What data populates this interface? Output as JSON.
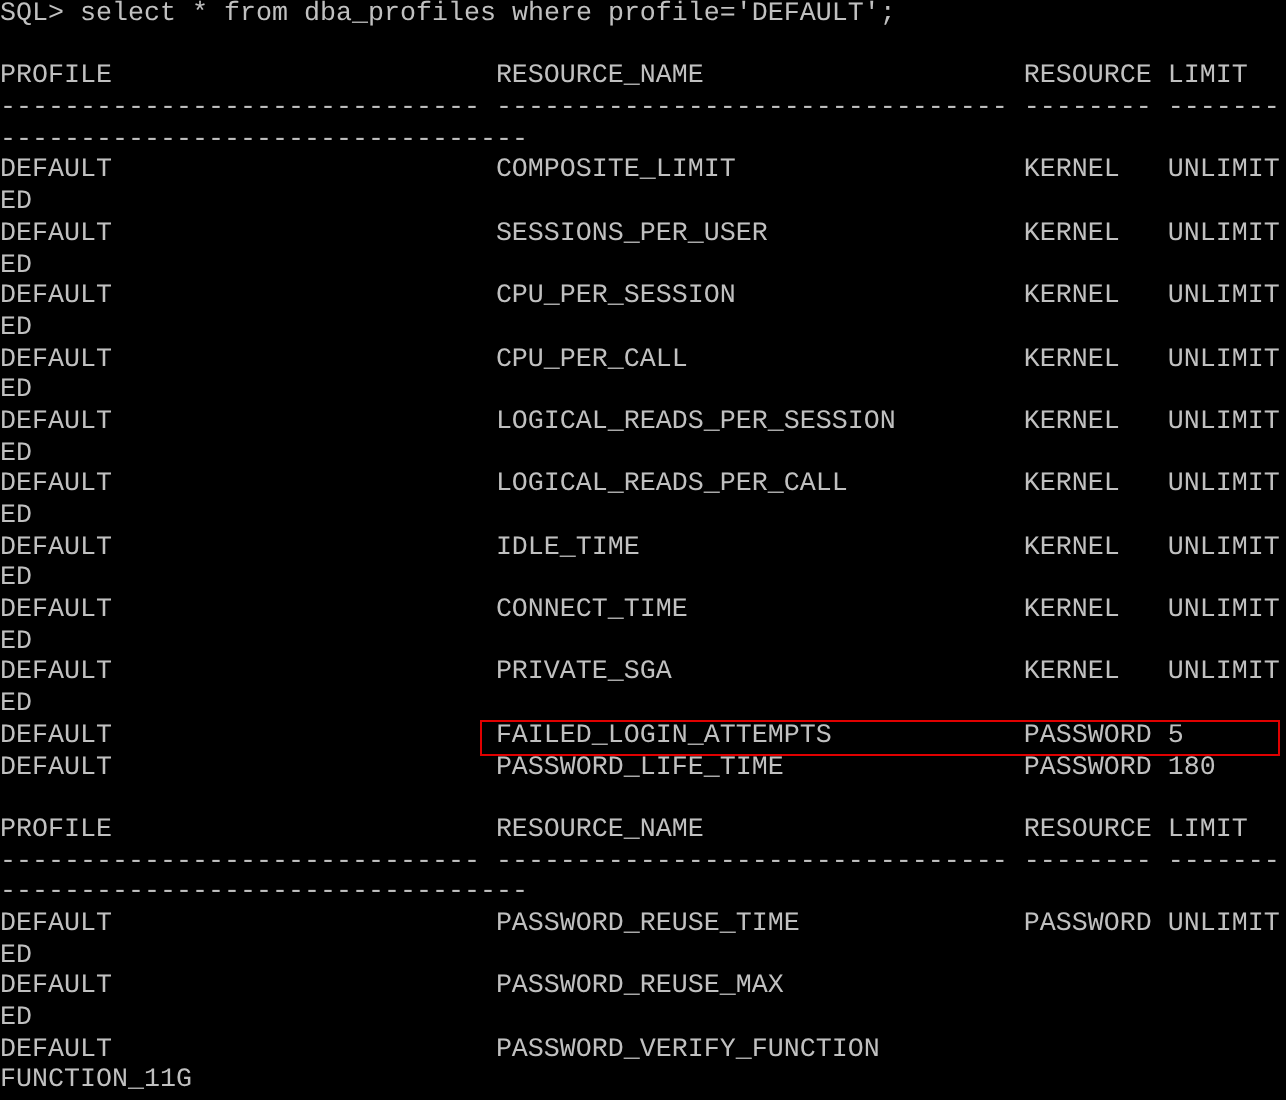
{
  "command": {
    "prompt": "SQL>",
    "text": "select * from dba_profiles where profile='DEFAULT';"
  },
  "result_blocks": [
    {
      "headers": {
        "profile": "PROFILE",
        "resource_name": "RESOURCE_NAME",
        "resource": "RESOURCE",
        "limit": "LIMIT"
      },
      "separator_1": "------------------------------ -------------------------------- -------- -------",
      "separator_2": "---------------------------------",
      "rows": [
        {
          "profile": "DEFAULT",
          "resource_name": "COMPOSITE_LIMIT",
          "resource": "KERNEL",
          "limit": "UNLIMIT",
          "limit_wrap": "ED",
          "highlighted": false
        },
        {
          "profile": "DEFAULT",
          "resource_name": "SESSIONS_PER_USER",
          "resource": "KERNEL",
          "limit": "UNLIMIT",
          "limit_wrap": "ED",
          "highlighted": false
        },
        {
          "profile": "DEFAULT",
          "resource_name": "CPU_PER_SESSION",
          "resource": "KERNEL",
          "limit": "UNLIMIT",
          "limit_wrap": "ED",
          "highlighted": false
        },
        {
          "profile": "DEFAULT",
          "resource_name": "CPU_PER_CALL",
          "resource": "KERNEL",
          "limit": "UNLIMIT",
          "limit_wrap": "ED",
          "highlighted": false
        },
        {
          "profile": "DEFAULT",
          "resource_name": "LOGICAL_READS_PER_SESSION",
          "resource": "KERNEL",
          "limit": "UNLIMIT",
          "limit_wrap": "ED",
          "highlighted": false
        },
        {
          "profile": "DEFAULT",
          "resource_name": "LOGICAL_READS_PER_CALL",
          "resource": "KERNEL",
          "limit": "UNLIMIT",
          "limit_wrap": "ED",
          "highlighted": false
        },
        {
          "profile": "DEFAULT",
          "resource_name": "IDLE_TIME",
          "resource": "KERNEL",
          "limit": "UNLIMIT",
          "limit_wrap": "ED",
          "highlighted": false
        },
        {
          "profile": "DEFAULT",
          "resource_name": "CONNECT_TIME",
          "resource": "KERNEL",
          "limit": "UNLIMIT",
          "limit_wrap": "ED",
          "highlighted": false
        },
        {
          "profile": "DEFAULT",
          "resource_name": "PRIVATE_SGA",
          "resource": "KERNEL",
          "limit": "UNLIMIT",
          "limit_wrap": "ED",
          "highlighted": false
        },
        {
          "profile": "DEFAULT",
          "resource_name": "FAILED_LOGIN_ATTEMPTS",
          "resource": "PASSWORD",
          "limit": "5",
          "highlighted": true
        },
        {
          "profile": "DEFAULT",
          "resource_name": "PASSWORD_LIFE_TIME",
          "resource": "PASSWORD",
          "limit": "180",
          "highlighted": false
        }
      ]
    },
    {
      "headers": {
        "profile": "PROFILE",
        "resource_name": "RESOURCE_NAME",
        "resource": "RESOURCE",
        "limit": "LIMIT"
      },
      "separator_1": "------------------------------ -------------------------------- -------- -------",
      "separator_2": "---------------------------------",
      "rows": [
        {
          "profile": "DEFAULT",
          "resource_name": "PASSWORD_REUSE_TIME",
          "resource": "PASSWORD",
          "limit": "UNLIMIT",
          "limit_wrap": "ED",
          "highlighted": false
        },
        {
          "profile": "DEFAULT",
          "resource_name": "PASSWORD_REUSE_MAX",
          "limit_wrap": "ED",
          "highlighted": false
        },
        {
          "profile": "DEFAULT",
          "resource_name": "PASSWORD_VERIFY_FUNCTION",
          "limit_wrap": "FUNCTION_11G",
          "highlighted": false
        }
      ]
    }
  ]
}
